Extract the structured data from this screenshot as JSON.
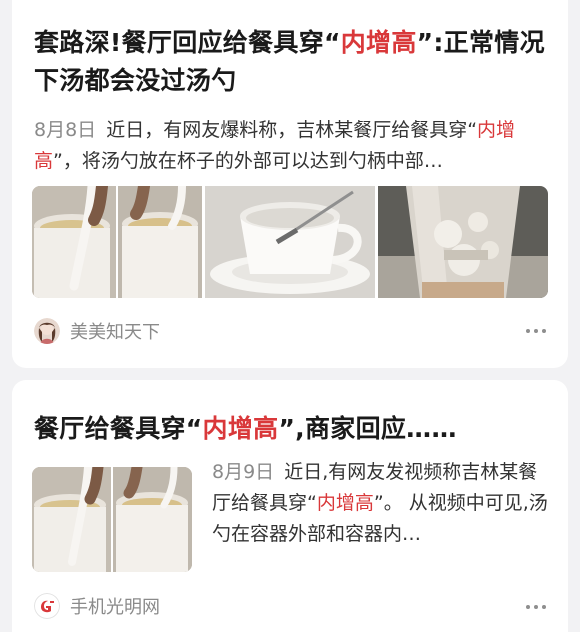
{
  "articles": [
    {
      "title_before": "套路深!餐厅回应给餐具穿“",
      "title_highlight": "内增高",
      "title_after": "”:正常情况下汤都会没过汤勺",
      "date": "8月8日",
      "snippet_before": "近日，有网友爆料称，吉林某餐厅给餐具穿“",
      "snippet_highlight": "内增高",
      "snippet_after": "”，将汤勺放在杯子的外部可以达到勺柄中部…",
      "source": "美美知天下",
      "images": [
        "soup-cup-with-spoon-photo",
        "white-cup-and-saucer-photo",
        "iced-drink-cup-photo"
      ]
    },
    {
      "title_before": "餐厅给餐具穿“",
      "title_highlight": "内增高",
      "title_after": "”,商家回应……",
      "date": "8月9日",
      "snippet_before": "近日,有网友发视频称吉林某餐厅给餐具穿“",
      "snippet_highlight": "内增高",
      "snippet_after": "”。 从视频中可见,汤勺在容器外部和容器内…",
      "source": "手机光明网",
      "images": [
        "soup-cup-with-spoon-photo"
      ]
    }
  ],
  "colors": {
    "highlight": "#d9383a",
    "meta_text": "#8a8a8a",
    "card_bg": "#ffffff",
    "page_bg": "#f2f2f4"
  },
  "icons": {
    "more": "more-dots-icon"
  }
}
